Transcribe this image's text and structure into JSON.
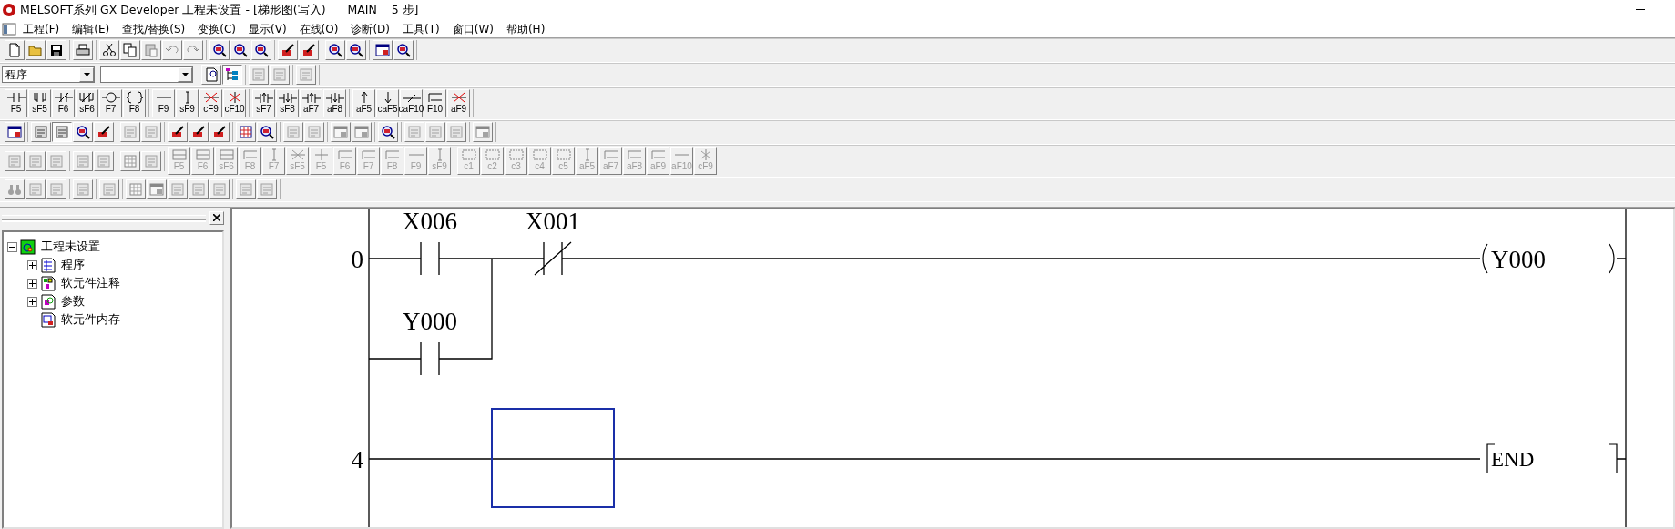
{
  "window": {
    "title": "MELSOFT系列 GX Developer 工程未设置 - [梯形图(写入)      MAIN    5 步]"
  },
  "menu": [
    {
      "label": "工程(F)"
    },
    {
      "label": "编辑(E)"
    },
    {
      "label": "查找/替换(S)"
    },
    {
      "label": "变换(C)"
    },
    {
      "label": "显示(V)"
    },
    {
      "label": "在线(O)"
    },
    {
      "label": "诊断(D)"
    },
    {
      "label": "工具(T)"
    },
    {
      "label": "窗口(W)"
    },
    {
      "label": "帮助(H)"
    }
  ],
  "toolbars": [
    {
      "groups": [
        {
          "kind": "buttons",
          "buttons": [
            {
              "kind": "new",
              "disabled": false,
              "pressed": false
            },
            {
              "kind": "open",
              "disabled": false,
              "pressed": false
            },
            {
              "kind": "save",
              "disabled": false,
              "pressed": false
            }
          ]
        },
        {
          "kind": "buttons",
          "buttons": [
            {
              "kind": "print",
              "disabled": false,
              "pressed": false
            }
          ]
        },
        {
          "kind": "buttons",
          "buttons": [
            {
              "kind": "cut",
              "disabled": false,
              "pressed": false
            },
            {
              "kind": "copy",
              "disabled": false,
              "pressed": false
            },
            {
              "kind": "paste",
              "disabled": true,
              "pressed": false
            },
            {
              "kind": "undo",
              "disabled": true,
              "pressed": false
            },
            {
              "kind": "redo",
              "disabled": true,
              "pressed": false
            }
          ]
        },
        {
          "kind": "buttons",
          "buttons": [
            {
              "kind": "magnifier",
              "disabled": false,
              "pressed": false
            },
            {
              "kind": "magnifier",
              "disabled": false,
              "pressed": false
            },
            {
              "kind": "magnifier",
              "disabled": false,
              "pressed": false
            }
          ]
        },
        {
          "kind": "buttons",
          "buttons": [
            {
              "kind": "pencil",
              "disabled": false,
              "pressed": false
            },
            {
              "kind": "pencil",
              "disabled": false,
              "pressed": false
            }
          ]
        },
        {
          "kind": "buttons",
          "buttons": [
            {
              "kind": "magnifier",
              "disabled": false,
              "pressed": false
            },
            {
              "kind": "magnifier",
              "disabled": false,
              "pressed": false
            }
          ]
        },
        {
          "kind": "buttons",
          "buttons": [
            {
              "kind": "window",
              "disabled": false,
              "pressed": false
            },
            {
              "kind": "magnifier",
              "disabled": false,
              "pressed": false
            }
          ]
        }
      ]
    },
    {
      "groups": [
        {
          "kind": "combo",
          "value": "程序"
        },
        {
          "kind": "combo"
        },
        {
          "kind": "buttons",
          "buttons": [
            {
              "kind": "doc",
              "disabled": false,
              "pressed": false
            },
            {
              "kind": "tree",
              "disabled": false,
              "pressed": true
            }
          ]
        },
        {
          "kind": "buttons",
          "buttons": [
            {
              "kind": "tool",
              "disabled": true,
              "pressed": false
            },
            {
              "kind": "tool",
              "disabled": true,
              "pressed": false
            }
          ]
        },
        {
          "kind": "buttons",
          "buttons": [
            {
              "kind": "tool",
              "disabled": true,
              "pressed": false
            }
          ]
        }
      ]
    },
    {
      "groups": [
        {
          "kind": "buttons",
          "buttons": [
            {
              "label": "F5",
              "kind": "no",
              "disabled": false,
              "pressed": false
            },
            {
              "label": "sF5",
              "kind": "pno",
              "disabled": false,
              "pressed": false
            },
            {
              "label": "F6",
              "kind": "nc",
              "disabled": false,
              "pressed": false
            },
            {
              "label": "sF6",
              "kind": "pnc",
              "disabled": false,
              "pressed": false
            },
            {
              "label": "F7",
              "kind": "coil",
              "disabled": false,
              "pressed": false
            },
            {
              "label": "F8",
              "kind": "func",
              "disabled": false,
              "pressed": false
            }
          ]
        },
        {
          "kind": "buttons",
          "buttons": [
            {
              "label": "F9",
              "kind": "hline",
              "disabled": false,
              "pressed": false
            },
            {
              "label": "sF9",
              "kind": "vline",
              "disabled": false,
              "pressed": false
            },
            {
              "label": "cF9",
              "kind": "hdel",
              "disabled": false,
              "pressed": false
            },
            {
              "label": "cF10",
              "kind": "vdel",
              "disabled": false,
              "pressed": false
            }
          ]
        },
        {
          "kind": "buttons",
          "buttons": [
            {
              "label": "sF7",
              "kind": "pup",
              "disabled": false,
              "pressed": false
            },
            {
              "label": "sF8",
              "kind": "pdown",
              "disabled": false,
              "pressed": false
            },
            {
              "label": "aF7",
              "kind": "pup",
              "disabled": false,
              "pressed": false
            },
            {
              "label": "aF8",
              "kind": "pdown",
              "disabled": false,
              "pressed": false
            }
          ]
        },
        {
          "kind": "buttons",
          "buttons": [
            {
              "label": "aF5",
              "kind": "up",
              "disabled": false,
              "pressed": false
            },
            {
              "label": "caF5",
              "kind": "down",
              "disabled": false,
              "pressed": false
            },
            {
              "label": "caF10",
              "kind": "invert",
              "disabled": false,
              "pressed": false
            },
            {
              "label": "F10",
              "kind": "corner",
              "disabled": false,
              "pressed": false
            },
            {
              "label": "aF9",
              "kind": "hdel",
              "disabled": false,
              "pressed": false
            }
          ]
        }
      ]
    },
    {
      "groups": [
        {
          "kind": "buttons",
          "buttons": [
            {
              "kind": "window",
              "disabled": false,
              "pressed": false
            }
          ]
        },
        {
          "kind": "buttons",
          "buttons": [
            {
              "kind": "tool",
              "disabled": false,
              "pressed": false
            },
            {
              "kind": "tool",
              "disabled": false,
              "pressed": true
            },
            {
              "kind": "magnifier",
              "disabled": false,
              "pressed": false
            },
            {
              "kind": "pencil",
              "disabled": false,
              "pressed": false
            }
          ]
        },
        {
          "kind": "buttons",
          "buttons": [
            {
              "kind": "tool",
              "disabled": true,
              "pressed": false
            },
            {
              "kind": "tool",
              "disabled": true,
              "pressed": false
            }
          ]
        },
        {
          "kind": "buttons",
          "buttons": [
            {
              "kind": "pencil",
              "disabled": false,
              "pressed": false
            },
            {
              "kind": "pencil",
              "disabled": false,
              "pressed": false
            },
            {
              "kind": "pencil",
              "disabled": false,
              "pressed": false
            }
          ]
        },
        {
          "kind": "buttons",
          "buttons": [
            {
              "kind": "grid",
              "disabled": false,
              "pressed": false
            },
            {
              "kind": "magnifier",
              "disabled": false,
              "pressed": false
            }
          ]
        },
        {
          "kind": "buttons",
          "buttons": [
            {
              "kind": "tool",
              "disabled": true,
              "pressed": false
            },
            {
              "kind": "tool",
              "disabled": true,
              "pressed": false
            }
          ]
        },
        {
          "kind": "buttons",
          "buttons": [
            {
              "kind": "window",
              "disabled": true,
              "pressed": false
            },
            {
              "kind": "window",
              "disabled": true,
              "pressed": false
            }
          ]
        },
        {
          "kind": "buttons",
          "buttons": [
            {
              "kind": "magnifier",
              "disabled": false,
              "pressed": false
            }
          ]
        },
        {
          "kind": "buttons",
          "buttons": [
            {
              "kind": "tool",
              "disabled": true,
              "pressed": false
            },
            {
              "kind": "tool",
              "disabled": true,
              "pressed": false
            },
            {
              "kind": "tool",
              "disabled": true,
              "pressed": false
            }
          ]
        },
        {
          "kind": "buttons",
          "buttons": [
            {
              "kind": "window",
              "disabled": true,
              "pressed": false
            }
          ]
        }
      ]
    },
    {
      "groups": [
        {
          "kind": "buttons",
          "buttons": [
            {
              "kind": "tool",
              "disabled": true,
              "pressed": false
            },
            {
              "kind": "tool",
              "disabled": true,
              "pressed": false
            },
            {
              "kind": "tool",
              "disabled": true,
              "pressed": false
            }
          ]
        },
        {
          "kind": "buttons",
          "buttons": [
            {
              "kind": "tool",
              "disabled": true,
              "pressed": false
            },
            {
              "kind": "tool",
              "disabled": true,
              "pressed": false
            }
          ]
        },
        {
          "kind": "buttons",
          "buttons": [
            {
              "kind": "grid",
              "disabled": true,
              "pressed": false
            },
            {
              "kind": "tool",
              "disabled": true,
              "pressed": false
            }
          ]
        },
        {
          "kind": "buttons",
          "buttons": [
            {
              "label": "F5",
              "kind": "frame",
              "disabled": true,
              "pressed": false
            },
            {
              "label": "F6",
              "kind": "frame",
              "disabled": true,
              "pressed": false
            },
            {
              "label": "sF6",
              "kind": "frame",
              "disabled": true,
              "pressed": false
            },
            {
              "label": "F8",
              "kind": "corner",
              "disabled": true,
              "pressed": false
            },
            {
              "label": "F7",
              "kind": "vline",
              "disabled": true,
              "pressed": false
            },
            {
              "label": "sF5",
              "kind": "hdel",
              "disabled": true,
              "pressed": false
            },
            {
              "label": "F5",
              "kind": "cross",
              "disabled": true,
              "pressed": false
            },
            {
              "label": "F6",
              "kind": "corner",
              "disabled": true,
              "pressed": false
            },
            {
              "label": "F7",
              "kind": "corner",
              "disabled": true,
              "pressed": false
            },
            {
              "label": "F8",
              "kind": "corner",
              "disabled": true,
              "pressed": false
            },
            {
              "label": "F9",
              "kind": "hline",
              "disabled": true,
              "pressed": false
            },
            {
              "label": "sF9",
              "kind": "vline",
              "disabled": true,
              "pressed": false
            }
          ]
        },
        {
          "kind": "buttons",
          "buttons": [
            {
              "label": "c1",
              "kind": "dashbox",
              "disabled": true,
              "pressed": false
            },
            {
              "label": "c2",
              "kind": "dashbox",
              "disabled": true,
              "pressed": false
            },
            {
              "label": "c3",
              "kind": "dashbox",
              "disabled": true,
              "pressed": false
            },
            {
              "label": "c4",
              "kind": "dashbox",
              "disabled": true,
              "pressed": false
            },
            {
              "label": "c5",
              "kind": "dashbox",
              "disabled": true,
              "pressed": false
            },
            {
              "label": "aF5",
              "kind": "vline",
              "disabled": true,
              "pressed": false
            },
            {
              "label": "aF7",
              "kind": "corner",
              "disabled": true,
              "pressed": false
            },
            {
              "label": "aF8",
              "kind": "corner",
              "disabled": true,
              "pressed": false
            },
            {
              "label": "aF9",
              "kind": "corner",
              "disabled": true,
              "pressed": false
            },
            {
              "label": "aF10",
              "kind": "hline",
              "disabled": true,
              "pressed": false
            },
            {
              "label": "cF9",
              "kind": "vdel",
              "disabled": true,
              "pressed": false
            }
          ]
        }
      ]
    },
    {
      "groups": [
        {
          "kind": "buttons",
          "buttons": [
            {
              "kind": "binoculars",
              "disabled": true,
              "pressed": false
            },
            {
              "kind": "tool",
              "disabled": true,
              "pressed": false
            },
            {
              "kind": "tool",
              "disabled": true,
              "pressed": false
            }
          ]
        },
        {
          "kind": "buttons",
          "buttons": [
            {
              "kind": "tool",
              "disabled": true,
              "pressed": false
            }
          ]
        },
        {
          "kind": "buttons",
          "buttons": [
            {
              "kind": "tool",
              "disabled": true,
              "pressed": false
            }
          ]
        },
        {
          "kind": "buttons",
          "buttons": [
            {
              "kind": "grid",
              "disabled": true,
              "pressed": false
            },
            {
              "kind": "window",
              "disabled": true,
              "pressed": false
            },
            {
              "kind": "tool",
              "disabled": true,
              "pressed": false
            },
            {
              "kind": "tool",
              "disabled": true,
              "pressed": false
            },
            {
              "kind": "tool",
              "disabled": true,
              "pressed": false
            }
          ]
        },
        {
          "kind": "buttons",
          "buttons": [
            {
              "kind": "tool",
              "disabled": true,
              "pressed": false
            },
            {
              "kind": "tool",
              "disabled": true,
              "pressed": false
            }
          ]
        }
      ]
    }
  ],
  "project_tree": {
    "label": "工程未设置",
    "kind": "project",
    "expanded": true,
    "children": [
      {
        "label": "程序",
        "kind": "program",
        "expanded": false
      },
      {
        "label": "软元件注释",
        "kind": "comment",
        "expanded": false
      },
      {
        "label": "参数",
        "kind": "parameter",
        "expanded": false
      },
      {
        "label": "软元件内存",
        "kind": "memory"
      }
    ]
  },
  "ladder": {
    "rungs": [
      {
        "step": "0",
        "cursor": false,
        "contacts": [
          {
            "device": "X006",
            "kind": "no"
          },
          {
            "device": "X001",
            "kind": "nc"
          }
        ],
        "branch": [
          {
            "device": "Y000",
            "kind": "no"
          }
        ],
        "output": {
          "device": "Y000",
          "kind": "coil"
        }
      },
      {
        "step": "4",
        "cursor": true,
        "output": {
          "device": "END",
          "kind": "end"
        }
      }
    ]
  }
}
